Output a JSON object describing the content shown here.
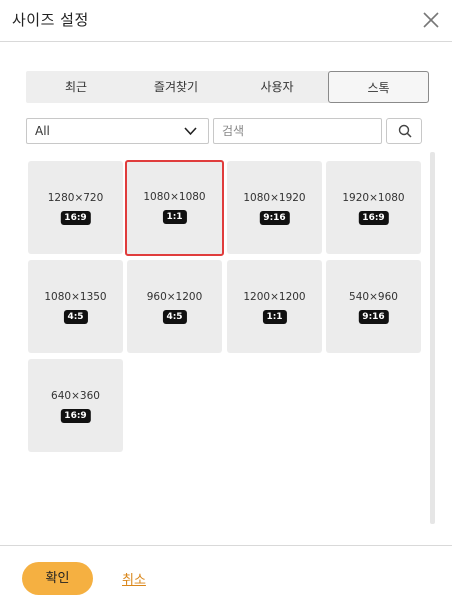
{
  "header": {
    "title": "사이즈 설정"
  },
  "tabs": [
    {
      "label": "최근"
    },
    {
      "label": "즐겨찾기"
    },
    {
      "label": "사용자"
    },
    {
      "label": "스톡",
      "active": true
    }
  ],
  "filter": {
    "selected": "All"
  },
  "search": {
    "placeholder": "검색"
  },
  "presets": [
    {
      "size": "1280×720",
      "ratio": "16:9"
    },
    {
      "size": "1080×1080",
      "ratio": "1:1",
      "selected": true
    },
    {
      "size": "1080×1920",
      "ratio": "9:16"
    },
    {
      "size": "1920×1080",
      "ratio": "16:9"
    },
    {
      "size": "1080×1350",
      "ratio": "4:5"
    },
    {
      "size": "960×1200",
      "ratio": "4:5"
    },
    {
      "size": "1200×1200",
      "ratio": "1:1"
    },
    {
      "size": "540×960",
      "ratio": "9:16"
    },
    {
      "size": "640×360",
      "ratio": "16:9"
    }
  ],
  "footer": {
    "ok_label": "확인",
    "cancel_label": "취소"
  },
  "colors": {
    "accent": "#f5b041",
    "selected_border": "#e03c3c",
    "link": "#d9861a"
  }
}
